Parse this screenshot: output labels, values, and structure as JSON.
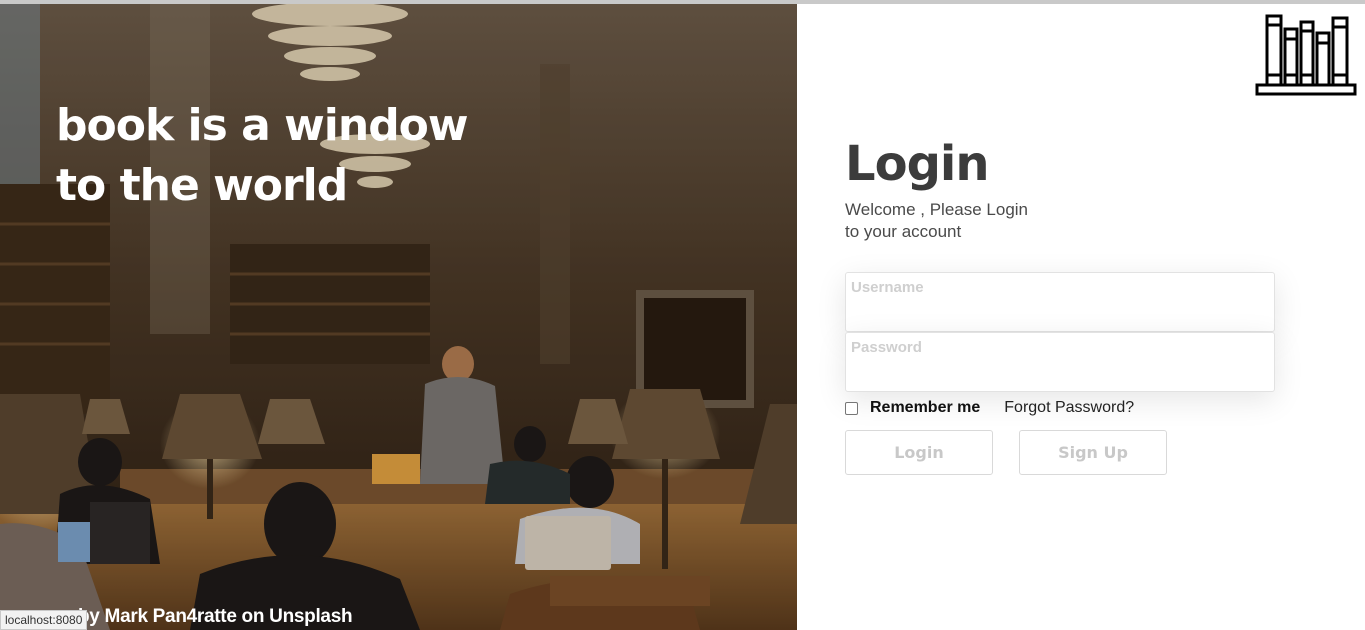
{
  "hero": {
    "line1": "book is a window",
    "line2": "to the world"
  },
  "photo_credit": "by Mark Pan4ratte on Unsplash",
  "status_bar": "localhost:8080",
  "logo_icon": "bookshelf-icon",
  "login": {
    "title": "Login",
    "subtitle_line1": "Welcome , Please Login",
    "subtitle_line2": "to your account",
    "username_label": "Username",
    "username_value": "",
    "password_label": "Password",
    "password_value": "",
    "remember_label": "Remember me",
    "remember_checked": false,
    "forgot_label": "Forgot Password?",
    "login_button": "Login",
    "signup_button": "Sign Up"
  },
  "colors": {
    "title": "#3c3c3c",
    "button_text": "#c8c8c8",
    "field_label": "#cfcfcf"
  }
}
